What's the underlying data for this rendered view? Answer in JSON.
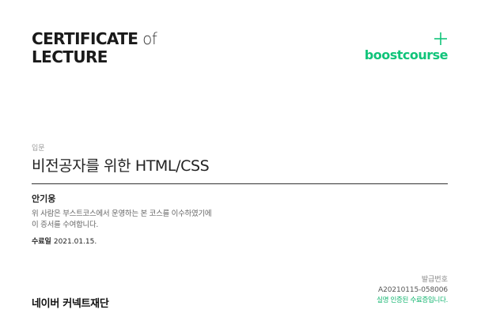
{
  "certificate": {
    "title_line1_strong": "CERTIFICATE",
    "title_line1_light": " of",
    "title_line2": "LECTURE"
  },
  "brand": {
    "name": "boostcourse",
    "icon": "plus-icon",
    "color": "#10c47a"
  },
  "course": {
    "level": "입문",
    "name": "비전공자를 위한 HTML/CSS"
  },
  "recipient": {
    "name": "안기웅",
    "desc_line1": "위 사람은 부스트코스에서 운영하는 본 코스를 이수하였기에",
    "desc_line2": "이 증서를 수여합니다.",
    "completion_label": "수료일",
    "completion_date": "2021.01.15."
  },
  "issuer": "네이버 커넥트재단",
  "issue": {
    "label": "발급번호",
    "number": "A20210115-058006",
    "verified_text": "실명 인증된 수료증입니다.",
    "verified_color": "#10b46e"
  }
}
